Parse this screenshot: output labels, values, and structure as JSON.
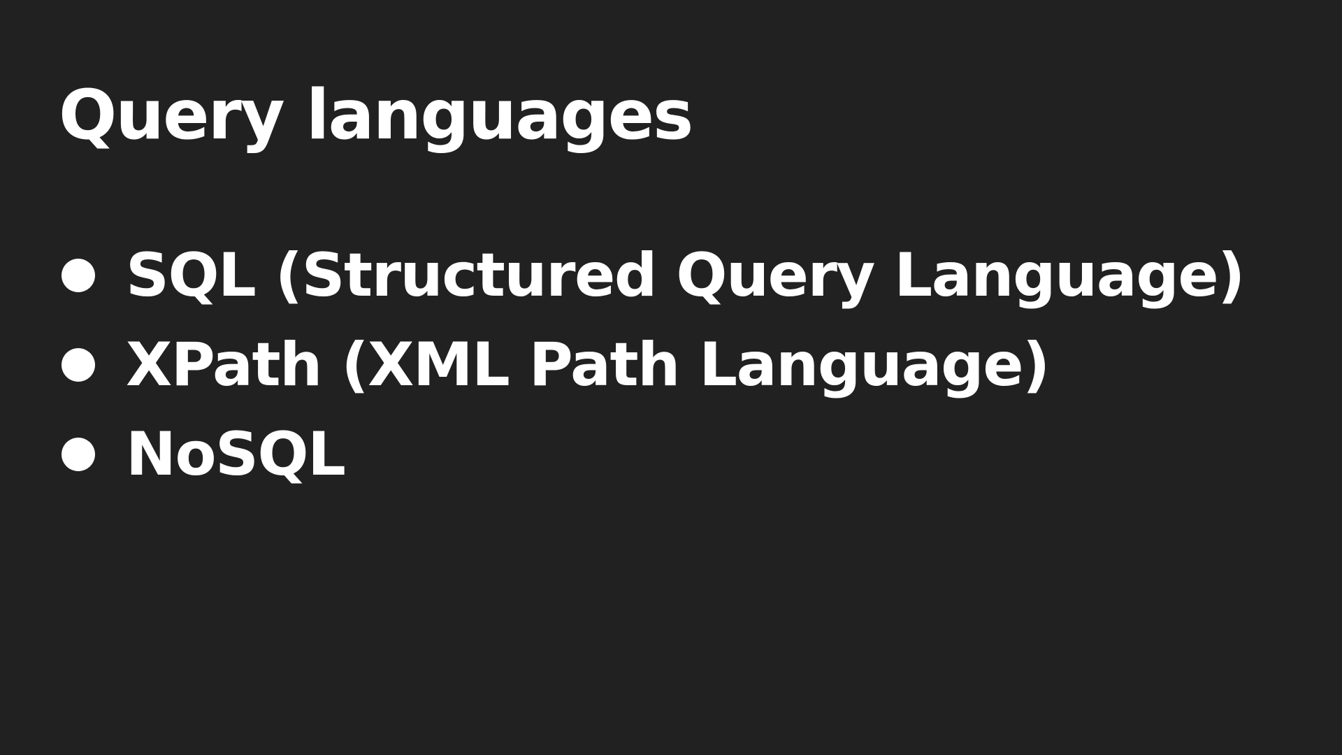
{
  "slide": {
    "title": "Query languages",
    "bullets": [
      {
        "text": "SQL (Structured Query Language)"
      },
      {
        "text": "XPath (XML Path Language)"
      },
      {
        "text": "NoSQL"
      }
    ]
  },
  "colors": {
    "background": "#212121",
    "text": "#ffffff"
  }
}
